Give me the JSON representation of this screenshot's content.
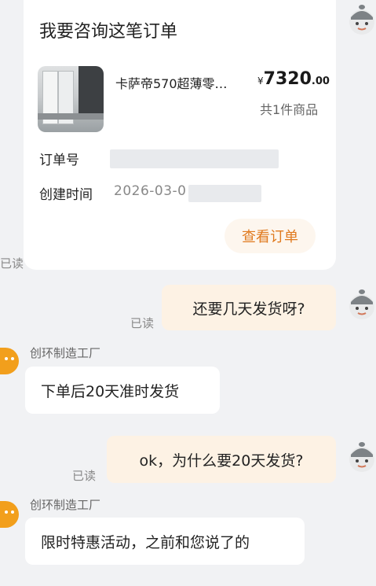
{
  "order_card": {
    "title": "我要咨询这笔订单",
    "product_name": "卡萨帝570超薄零…",
    "price_currency": "¥",
    "price_integer": "7320",
    "price_decimal": ".00",
    "item_count": "共1件商品",
    "order_no_label": "订单号",
    "created_label": "创建时间",
    "created_value": "2026-03-0",
    "view_button": "查看订单"
  },
  "messages": [
    {
      "side": "right",
      "text": "还要几天发货呀?",
      "status": "已读"
    },
    {
      "side": "left",
      "sender": "创环制造工厂",
      "text": "下单后20天准时发货"
    },
    {
      "side": "right",
      "text": "ok，为什么要20天发货?",
      "status": "已读"
    },
    {
      "side": "left",
      "sender": "创环制造工厂",
      "text": "限时特惠活动，之前和您说了的"
    }
  ],
  "edge_read_label": "已读",
  "colors": {
    "accent": "#e07a1f",
    "right_bubble": "#fdf2e4",
    "shop_avatar": "#f29f1c"
  },
  "icons": [
    "user-avatar-icon",
    "shop-avatar-icon",
    "product-thumbnail"
  ]
}
